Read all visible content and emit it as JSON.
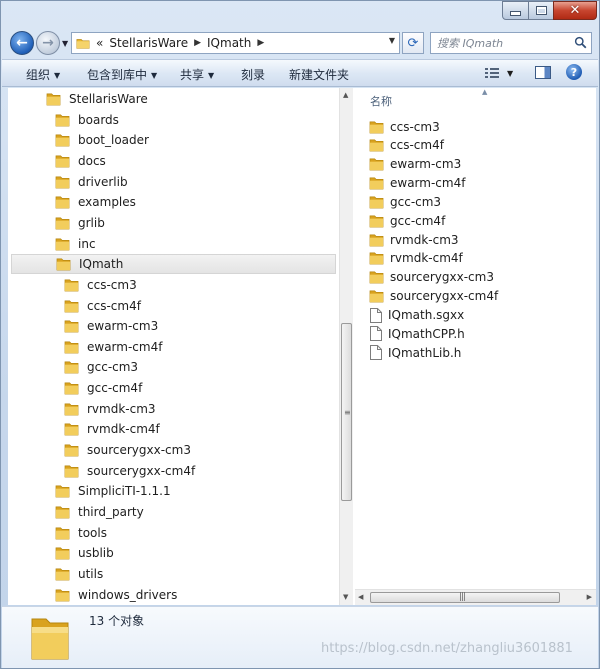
{
  "window": {
    "colors": {
      "accent": "#1f5fb8",
      "close": "#c7452f",
      "selection": "#e4e4e4",
      "folder": "#e8b62a"
    }
  },
  "address_bar": {
    "overflow_marker": "«",
    "segments": [
      "StellarisWare",
      "IQmath"
    ]
  },
  "search": {
    "placeholder": "搜索 IQmath",
    "icon": "search-icon"
  },
  "toolbar": {
    "organize": "组织",
    "include_in_library": "包含到库中",
    "share": "共享",
    "burn": "刻录",
    "new_folder": "新建文件夹"
  },
  "nav_tree": {
    "items": [
      {
        "label": "StellarisWare",
        "level": 0,
        "selected": false
      },
      {
        "label": "boards",
        "level": 1,
        "selected": false
      },
      {
        "label": "boot_loader",
        "level": 1,
        "selected": false
      },
      {
        "label": "docs",
        "level": 1,
        "selected": false
      },
      {
        "label": "driverlib",
        "level": 1,
        "selected": false
      },
      {
        "label": "examples",
        "level": 1,
        "selected": false
      },
      {
        "label": "grlib",
        "level": 1,
        "selected": false
      },
      {
        "label": "inc",
        "level": 1,
        "selected": false
      },
      {
        "label": "IQmath",
        "level": 1,
        "selected": true
      },
      {
        "label": "ccs-cm3",
        "level": 2,
        "selected": false
      },
      {
        "label": "ccs-cm4f",
        "level": 2,
        "selected": false
      },
      {
        "label": "ewarm-cm3",
        "level": 2,
        "selected": false
      },
      {
        "label": "ewarm-cm4f",
        "level": 2,
        "selected": false
      },
      {
        "label": "gcc-cm3",
        "level": 2,
        "selected": false
      },
      {
        "label": "gcc-cm4f",
        "level": 2,
        "selected": false
      },
      {
        "label": "rvmdk-cm3",
        "level": 2,
        "selected": false
      },
      {
        "label": "rvmdk-cm4f",
        "level": 2,
        "selected": false
      },
      {
        "label": "sourcerygxx-cm3",
        "level": 2,
        "selected": false
      },
      {
        "label": "sourcerygxx-cm4f",
        "level": 2,
        "selected": false
      },
      {
        "label": "SimpliciTI-1.1.1",
        "level": 1,
        "selected": false
      },
      {
        "label": "third_party",
        "level": 1,
        "selected": false
      },
      {
        "label": "tools",
        "level": 1,
        "selected": false
      },
      {
        "label": "usblib",
        "level": 1,
        "selected": false
      },
      {
        "label": "utils",
        "level": 1,
        "selected": false
      },
      {
        "label": "windows_drivers",
        "level": 1,
        "selected": false
      }
    ]
  },
  "file_list": {
    "column_header": "名称",
    "items": [
      {
        "name": "ccs-cm3",
        "type": "folder"
      },
      {
        "name": "ccs-cm4f",
        "type": "folder"
      },
      {
        "name": "ewarm-cm3",
        "type": "folder"
      },
      {
        "name": "ewarm-cm4f",
        "type": "folder"
      },
      {
        "name": "gcc-cm3",
        "type": "folder"
      },
      {
        "name": "gcc-cm4f",
        "type": "folder"
      },
      {
        "name": "rvmdk-cm3",
        "type": "folder"
      },
      {
        "name": "rvmdk-cm4f",
        "type": "folder"
      },
      {
        "name": "sourcerygxx-cm3",
        "type": "folder"
      },
      {
        "name": "sourcerygxx-cm4f",
        "type": "folder"
      },
      {
        "name": "IQmath.sgxx",
        "type": "file"
      },
      {
        "name": "IQmathCPP.h",
        "type": "file"
      },
      {
        "name": "IQmathLib.h",
        "type": "file"
      }
    ]
  },
  "details_pane": {
    "item_count": "13 个对象"
  },
  "watermark": "https://blog.csdn.net/zhangliu3601881"
}
